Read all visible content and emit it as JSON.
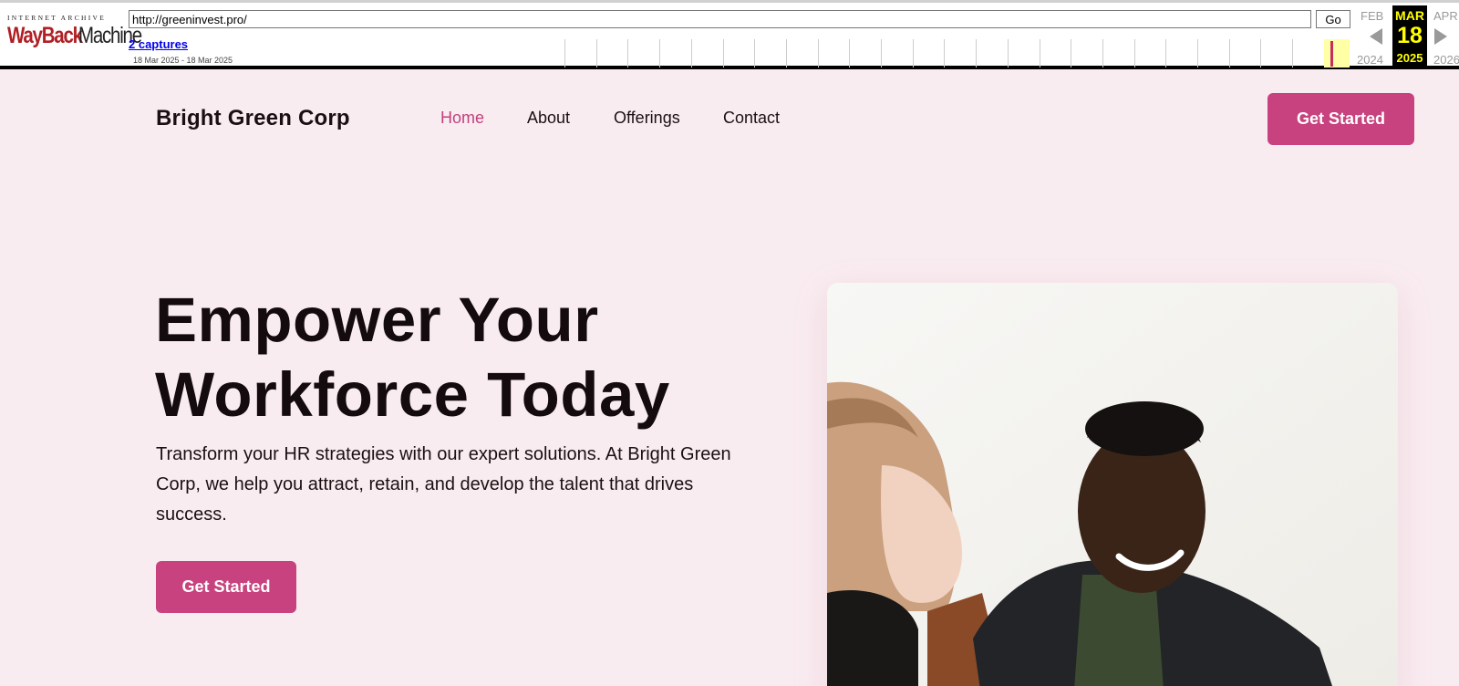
{
  "wayback": {
    "logo_top": "INTERNET ARCHIVE",
    "logo_way": "WayBack",
    "logo_machine": "Machine",
    "url": "http://greeninvest.pro/",
    "go_label": "Go",
    "captures_label": "2 captures",
    "date_range": "18 Mar 2025 - 18 Mar 2025",
    "prev_month": "FEB",
    "current_month": "MAR",
    "next_month": "APR",
    "current_day": "18",
    "prev_year": "2024",
    "current_year": "2025",
    "next_year": "2026"
  },
  "header": {
    "brand": "Bright Green Corp",
    "nav": [
      {
        "label": "Home",
        "active": true
      },
      {
        "label": "About",
        "active": false
      },
      {
        "label": "Offerings",
        "active": false
      },
      {
        "label": "Contact",
        "active": false
      }
    ],
    "cta_label": "Get Started"
  },
  "hero": {
    "title": "Empower Your Workforce Today",
    "description": "Transform your HR strategies with our expert solutions. At Bright Green Corp, we help you attract, retain, and develop the talent that drives success.",
    "cta_label": "Get Started"
  },
  "colors": {
    "accent": "#c7427e",
    "active_nav": "#c2407c",
    "background": "#f9ecf0",
    "wayback_highlight": "#ffff00"
  }
}
